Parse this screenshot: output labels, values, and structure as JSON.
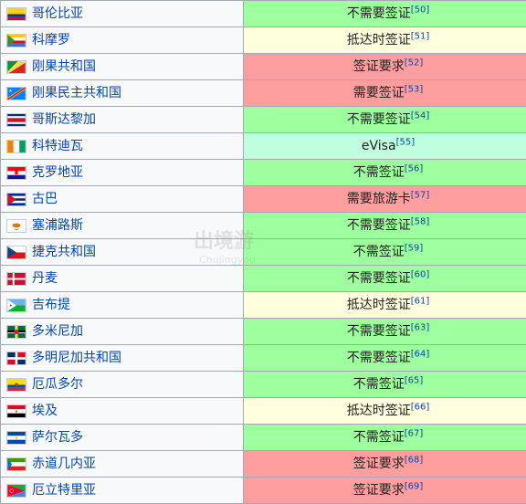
{
  "colors": {
    "green": "#9eff9e",
    "yellow": "#ffffdd",
    "red": "#ff9e9e",
    "teal": "#bfffe0"
  },
  "watermark": {
    "text": "出境游",
    "sub": "Chujingyou"
  },
  "rows": [
    {
      "country": "哥伦比亚",
      "flag": "colombia-flag-icon",
      "status": "不需要签证",
      "ref": "[50]",
      "color": "#9eff9e"
    },
    {
      "country": "科摩罗",
      "flag": "comoros-flag-icon",
      "status": "抵达时签证",
      "ref": "[51]",
      "color": "#ffffdd"
    },
    {
      "country": "刚果共和国",
      "flag": "congo-flag-icon",
      "status": "签证要求",
      "ref": "[52]",
      "color": "#ff9e9e"
    },
    {
      "country": "刚果民主共和国",
      "flag": "drc-flag-icon",
      "status": "需要签证",
      "ref": "[53]",
      "color": "#ff9e9e"
    },
    {
      "country": "哥斯达黎加",
      "flag": "costa-rica-flag-icon",
      "status": "不需要签证",
      "ref": "[54]",
      "color": "#9eff9e"
    },
    {
      "country": "科特迪瓦",
      "flag": "cote-divoire-flag-icon",
      "status": "eVisa",
      "ref": "[55]",
      "color": "#bfffe0"
    },
    {
      "country": "克罗地亚",
      "flag": "croatia-flag-icon",
      "status": "不需签证",
      "ref": "[56]",
      "color": "#9eff9e"
    },
    {
      "country": "古巴",
      "flag": "cuba-flag-icon",
      "status": "需要旅游卡",
      "ref": "[57]",
      "color": "#ff9e9e"
    },
    {
      "country": "塞浦路斯",
      "flag": "cyprus-flag-icon",
      "status": "不需要签证",
      "ref": "[58]",
      "color": "#9eff9e"
    },
    {
      "country": "捷克共和国",
      "flag": "czech-flag-icon",
      "status": "不需签证",
      "ref": "[59]",
      "color": "#9eff9e"
    },
    {
      "country": "丹麦",
      "flag": "denmark-flag-icon",
      "status": "不需要签证",
      "ref": "[60]",
      "color": "#9eff9e"
    },
    {
      "country": "吉布提",
      "flag": "djibouti-flag-icon",
      "status": "抵达时签证",
      "ref": "[61]",
      "color": "#ffffdd"
    },
    {
      "country": "多米尼加",
      "flag": "dominica-flag-icon",
      "status": "不需要签证",
      "ref": "[63]",
      "color": "#9eff9e"
    },
    {
      "country": "多明尼加共和国",
      "flag": "dominican-republic-flag-icon",
      "status": "不需要签证",
      "ref": "[64]",
      "color": "#9eff9e"
    },
    {
      "country": "厄瓜多尔",
      "flag": "ecuador-flag-icon",
      "status": "不需签证",
      "ref": "[65]",
      "color": "#9eff9e"
    },
    {
      "country": "埃及",
      "flag": "egypt-flag-icon",
      "status": "抵达时签证",
      "ref": "[66]",
      "color": "#ffffdd"
    },
    {
      "country": "萨尔瓦多",
      "flag": "el-salvador-flag-icon",
      "status": "不需签证",
      "ref": "[67]",
      "color": "#9eff9e"
    },
    {
      "country": "赤道几内亚",
      "flag": "equatorial-guinea-flag-icon",
      "status": "签证要求",
      "ref": "[68]",
      "color": "#ff9e9e"
    },
    {
      "country": "厄立特里亚",
      "flag": "eritrea-flag-icon",
      "status": "签证要求",
      "ref": "[69]",
      "color": "#ff9e9e"
    }
  ]
}
